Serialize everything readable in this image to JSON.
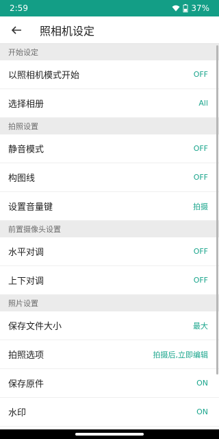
{
  "status": {
    "time": "2:59",
    "battery": "37%"
  },
  "header": {
    "title": "照相机设定"
  },
  "colors": {
    "accent": "#1aa58c",
    "statusbar": "#139e86"
  },
  "icons": {
    "back": "arrow-left",
    "wifi": "wifi",
    "battery": "battery"
  },
  "sections": [
    {
      "title": "开始设定",
      "items": [
        {
          "label": "以照相机模式开始",
          "value": "OFF"
        },
        {
          "label": "选择相册",
          "value": "All"
        }
      ]
    },
    {
      "title": "拍照设置",
      "items": [
        {
          "label": "静音模式",
          "value": "OFF"
        },
        {
          "label": "构图线",
          "value": "OFF"
        },
        {
          "label": "设置音量键",
          "value": "拍摄"
        }
      ]
    },
    {
      "title": "前置摄像头设置",
      "items": [
        {
          "label": "水平对调",
          "value": "OFF"
        },
        {
          "label": "上下对调",
          "value": "OFF"
        }
      ]
    },
    {
      "title": "照片设置",
      "items": [
        {
          "label": "保存文件大小",
          "value": "最大"
        },
        {
          "label": "拍照选项",
          "value": "拍摄后,立即编辑"
        },
        {
          "label": "保存原件",
          "value": "ON"
        },
        {
          "label": "水印",
          "value": "ON"
        }
      ]
    }
  ]
}
